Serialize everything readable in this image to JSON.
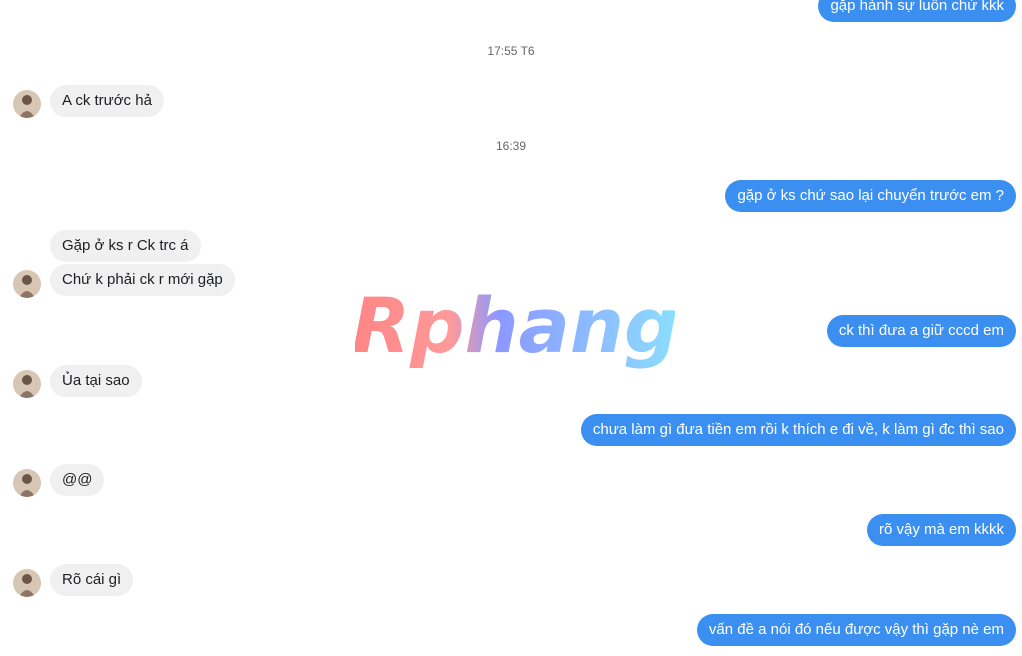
{
  "messages": {
    "out_1": "gặp hành sự luôn chứ kkk",
    "ts_1": "17:55 T6",
    "in_1": "A ck trước hả",
    "ts_2": "16:39",
    "out_2": "gặp ở ks chứ sao lại chuyển trước em ?",
    "in_2": "Gặp ở ks r Ck trc á",
    "in_3": "Chứ k phải ck r mới gặp",
    "out_3": "ck thì đưa a giữ cccd em",
    "in_4": "Ủa tại sao",
    "out_4": "chưa làm gì đưa tiền em rồi k thích e đi về, k làm gì đc thì sao",
    "in_5": "@@",
    "out_5": "rõ vậy mà em kkkk",
    "in_6": "Rõ cái gì",
    "out_6": "vấn đề a nói đó nếu được vậy thì gặp nè em"
  },
  "watermark": {
    "text": "Rphang"
  },
  "colors": {
    "outgoing_bubble": "#3b8ff0",
    "incoming_bubble": "#f0f0f0",
    "timestamp": "#65676b"
  }
}
